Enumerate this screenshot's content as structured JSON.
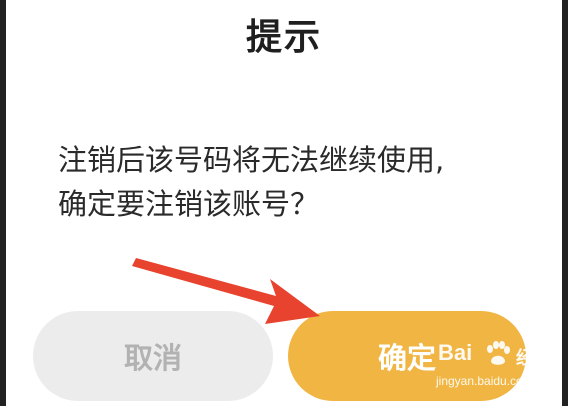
{
  "dialog": {
    "title": "提示",
    "message_line1": "注销后该号码将无法继续使用,",
    "message_line2": "确定要注销该账号？"
  },
  "buttons": {
    "cancel_label": "取消",
    "confirm_label": "确定"
  },
  "watermark": {
    "brand": "Bai",
    "brand_cn": "经验",
    "url": "jingyan.baidu.com"
  },
  "annotation": {
    "arrow_color": "#e8432e"
  },
  "colors": {
    "confirm_bg": "#f0b542",
    "cancel_bg": "#ececec"
  }
}
